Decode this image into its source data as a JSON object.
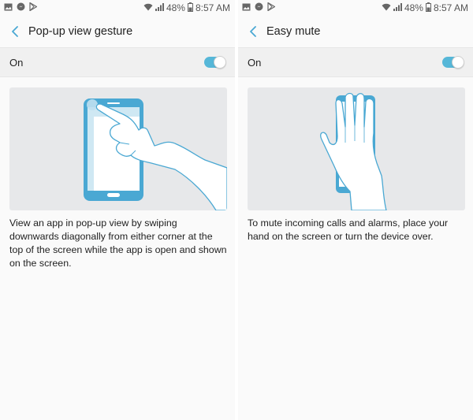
{
  "status_bar": {
    "battery_percent": "48%",
    "time": "8:57 AM",
    "left_icons": [
      "gallery-icon",
      "messenger-icon",
      "play-store-icon"
    ],
    "right_icons": [
      "wifi-icon",
      "signal-icon"
    ]
  },
  "colors": {
    "accent": "#56b7d8",
    "phone_blue": "#4aa8d3",
    "illustration_bg": "#e7e8ea"
  },
  "panes": [
    {
      "title": "Pop-up view gesture",
      "toggle_label": "On",
      "toggle_on": true,
      "illustration": "phone-swipe-gesture-illustration",
      "description": "View an app in pop-up view by swiping downwards diagonally from either corner at the top of the screen while the app is open and shown on the screen."
    },
    {
      "title": "Easy mute",
      "toggle_label": "On",
      "toggle_on": true,
      "illustration": "hand-cover-screen-illustration",
      "description": "To mute incoming calls and alarms, place your hand on the screen or turn the device over."
    }
  ]
}
